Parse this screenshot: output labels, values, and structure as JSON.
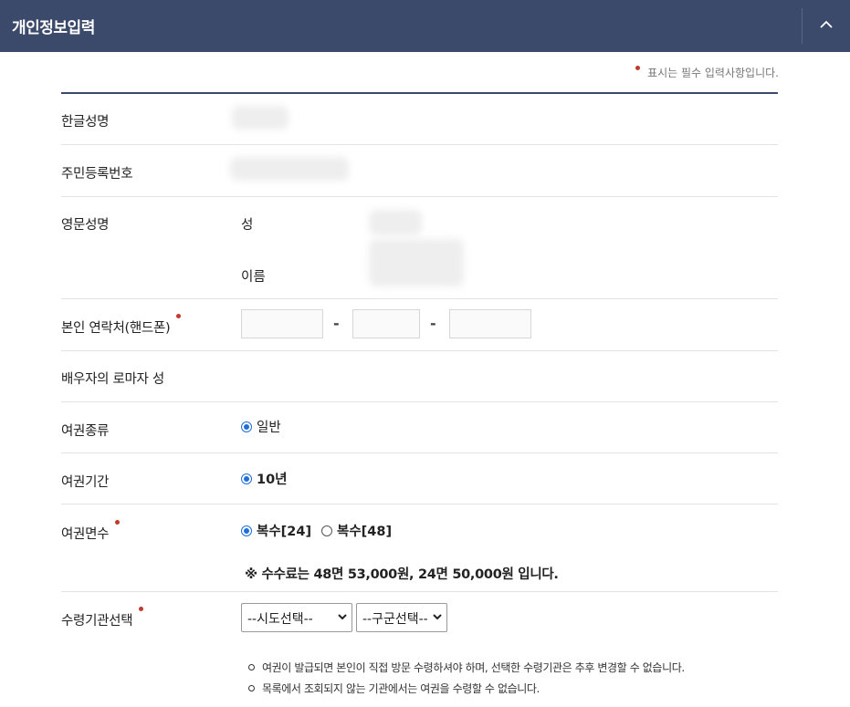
{
  "header": {
    "title": "개인정보입력",
    "collapse_icon": "chevron-up-icon"
  },
  "required_note": "표시는 필수 입력사항입니다.",
  "fields": {
    "korean_name": {
      "label": "한글성명"
    },
    "resident_number": {
      "label": "주민등록번호"
    },
    "english_name": {
      "label": "영문성명",
      "surname_label": "성",
      "given_name_label": "이름"
    },
    "phone": {
      "label": "본인 연락처(핸드폰)",
      "separator": "-"
    },
    "spouse_roman_surname": {
      "label": "배우자의 로마자 성"
    },
    "passport_type": {
      "label": "여권종류",
      "option": "일반"
    },
    "passport_period": {
      "label": "여권기간",
      "option": "10년"
    },
    "passport_pages": {
      "label": "여권면수",
      "option_1": "복수[24]",
      "option_2": "복수[48]",
      "selected": "복수[24]",
      "fee_note": "※ 수수료는 48면 53,000원, 24면 50,000원 입니다."
    },
    "pickup_agency": {
      "label": "수령기관선택",
      "sido_select": "--시도선택--",
      "gugun_select": "--구군선택--",
      "notes": [
        "여권이 발급되면 본인이 직접 방문 수령하셔야 하며, 선택한 수령기관은 추후 변경할 수 없습니다.",
        "목록에서 조회되지 않는 기관에서는 여권을 수령할 수 없습니다."
      ]
    }
  },
  "colors": {
    "header_bg": "#3b4a6b",
    "required_dot": "#c0392b",
    "radio_accent": "#1e6fd9"
  }
}
